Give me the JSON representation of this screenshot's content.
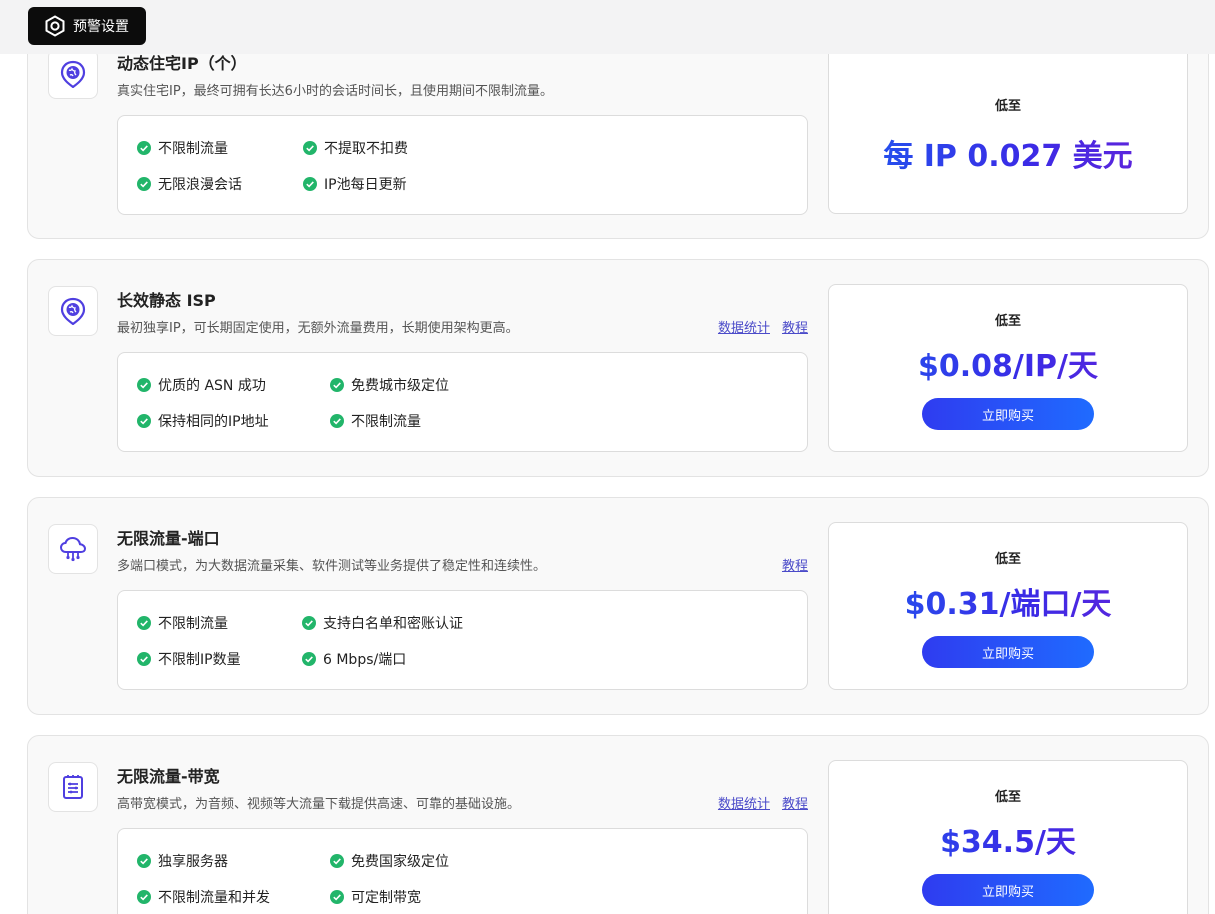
{
  "topbar": {
    "alert_label": "预警设置",
    "alert_icon": "hexagon-icon"
  },
  "colors": {
    "accent_blue": "#1e5bf0",
    "accent_purple": "#6b22d8",
    "check_green": "#22b56a"
  },
  "cards": [
    {
      "title": "动态住宅IP（个）",
      "desc": "真实住宅IP，最终可拥有长达6小时的会话时间长，且使用期间不限制流量。",
      "icon": "globe-pin-icon",
      "features": [
        "不限制流量",
        "不提取不扣费",
        "无限浪漫会话",
        "IP池每日更新"
      ],
      "lowest": "低至",
      "price": "每 IP 0.027 美元"
    },
    {
      "title": "长效静态 ISP",
      "desc": "最初独享IP，可长期固定使用，无额外流量费用，长期使用架构更高。",
      "icon": "globe-pin-icon",
      "links": [
        "数据统计",
        "教程"
      ],
      "features": [
        "优质的 ASN 成功",
        "免费城市级定位",
        "保持相同的IP地址",
        "不限制流量"
      ],
      "lowest": "低至",
      "price": "$0.08/IP/天",
      "buy": "立即购买"
    },
    {
      "title": "无限流量-端口",
      "desc": "多端口模式，为大数据流量采集、软件测试等业务提供了稳定性和连续性。",
      "icon": "cloud-network-icon",
      "links": [
        "教程"
      ],
      "features": [
        "不限制流量",
        "支持白名单和密账认证",
        "不限制IP数量",
        "6 Mbps/端口"
      ],
      "lowest": "低至",
      "price": "$0.31/端口/天",
      "buy": "立即购买"
    },
    {
      "title": "无限流量-带宽",
      "desc": "高带宽模式，为音频、视频等大流量下载提供高速、可靠的基础设施。",
      "icon": "server-chip-icon",
      "links": [
        "数据统计",
        "教程"
      ],
      "features": [
        "独享服务器",
        "免费国家级定位",
        "不限制流量和并发",
        "可定制带宽"
      ],
      "lowest": "低至",
      "price": "$34.5/天",
      "buy": "立即购买"
    }
  ]
}
